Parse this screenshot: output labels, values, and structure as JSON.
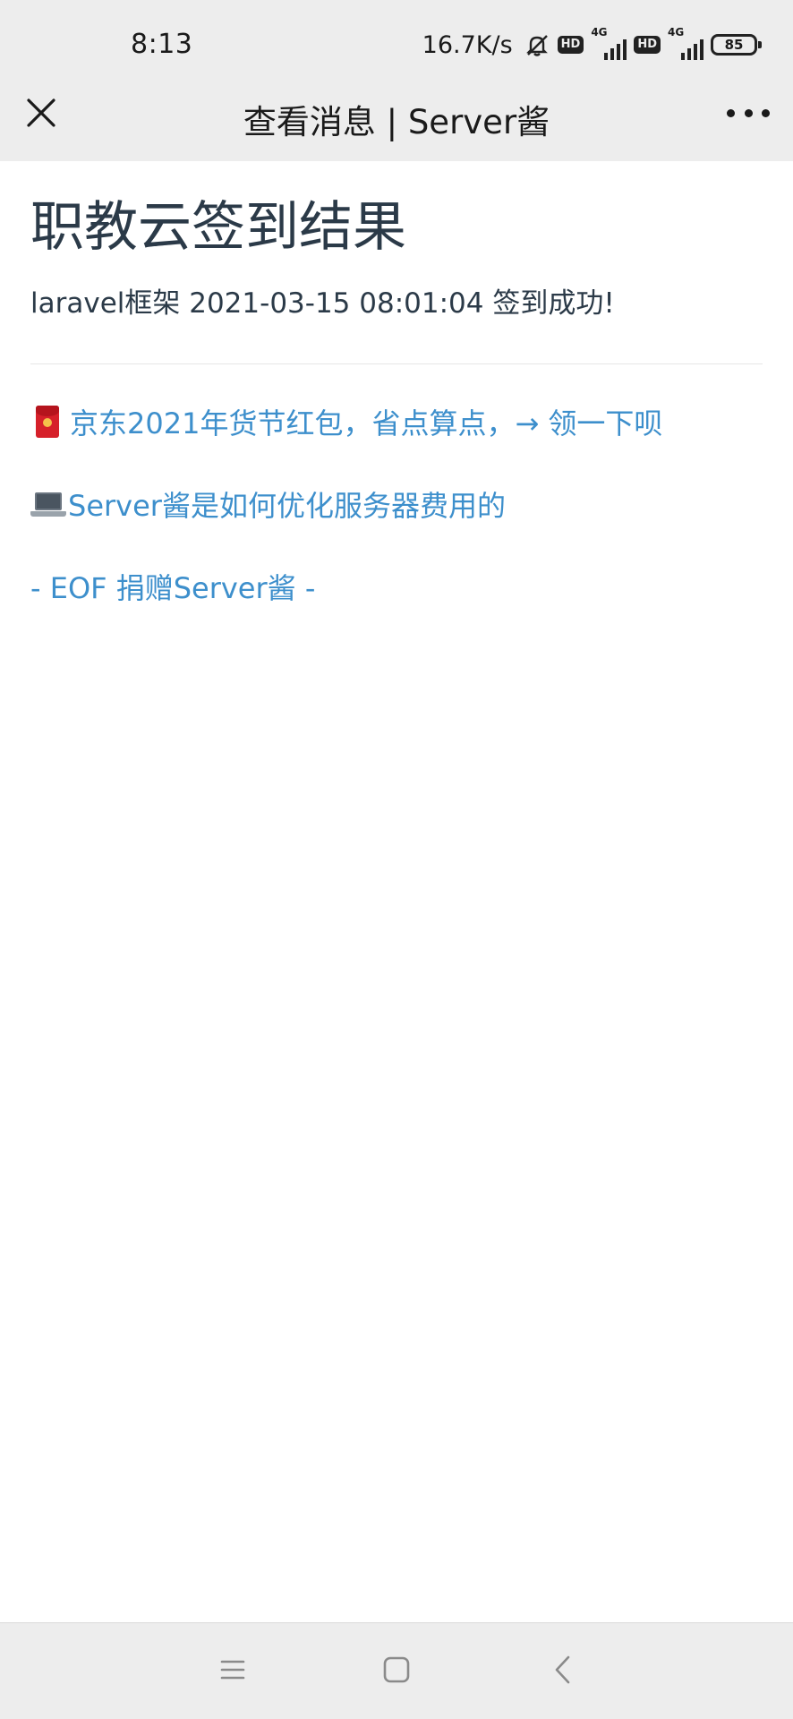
{
  "status_bar": {
    "time": "8:13",
    "net_speed": "16.7K/s",
    "hd_label": "HD",
    "network_type": "4G",
    "battery_level": "85",
    "icons": [
      "bell-off-icon",
      "signal-icon",
      "battery-icon"
    ]
  },
  "title_bar": {
    "title": "查看消息 | Server酱",
    "icons": [
      "close-icon",
      "more-icon"
    ]
  },
  "message": {
    "title": "职教云签到结果",
    "body": "laravel框架 2021-03-15 08:01:04 签到成功!"
  },
  "links": [
    {
      "icon": "red-packet-icon",
      "text": "京东2021年货节红包，省点算点，→ 领一下呗"
    },
    {
      "icon": "laptop-icon",
      "text": "Server酱是如何优化服务器费用的"
    },
    {
      "text": "- EOF 捐赠Server酱 -"
    }
  ],
  "nav_bar": {
    "icons": [
      "menu-icon",
      "home-icon",
      "back-icon"
    ]
  },
  "colors": {
    "bar_background": "#ededed",
    "link": "#3d8fcc",
    "heading": "#2b3a48"
  }
}
